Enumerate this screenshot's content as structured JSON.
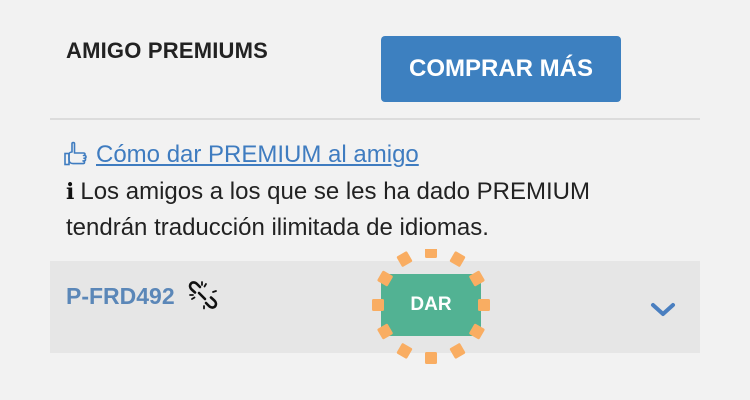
{
  "header": {
    "title": "AMIGO PREMIUMS",
    "buy_label": "COMPRAR MÁS"
  },
  "howto": {
    "icon": "pointing-hand-icon",
    "link_text": "Cómo dar PREMIUM al amigo"
  },
  "info": {
    "icon": "info-icon",
    "text": "Los amigos a los que se les ha dado PREMIUM tendrán traducción ilimitada de idiomas."
  },
  "friend": {
    "id": "P-FRD492",
    "link_icon": "unlink-icon",
    "give_label": "DAR",
    "expand_icon": "chevron-down-icon"
  },
  "colors": {
    "buy_button": "#3d80c0",
    "link": "#3f7cc0",
    "friend_id": "#5b87b8",
    "give_button": "#52b293",
    "highlight": "#f9ad62",
    "row_background": "#e6e6e6",
    "page_background": "#f2f2f2"
  }
}
